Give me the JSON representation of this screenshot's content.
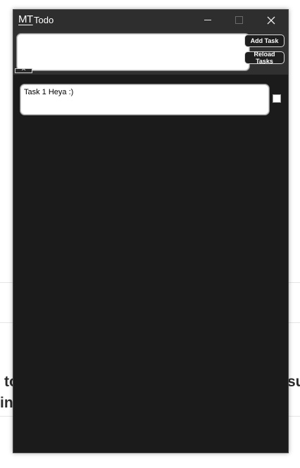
{
  "backdrop": {
    "line1": "to",
    "line1_right": "su",
    "line2": "in"
  },
  "window": {
    "logo": "MT",
    "title": "Todo",
    "controls": {
      "minimize_icon": "minimize-icon",
      "maximize_icon": "maximize-icon",
      "close_icon": "close-icon"
    }
  },
  "toolbar": {
    "task_input_value": "",
    "add_label": "Add Task",
    "reload_label": "Reload Tasks",
    "collapse_label": "^"
  },
  "tasks": [
    {
      "text": "Task 1 Heya :)",
      "done": false
    }
  ],
  "colors": {
    "window_bg": "#1b1b1b",
    "titlebar_bg": "#2e2e2e",
    "toolbar_bg": "#303030"
  }
}
